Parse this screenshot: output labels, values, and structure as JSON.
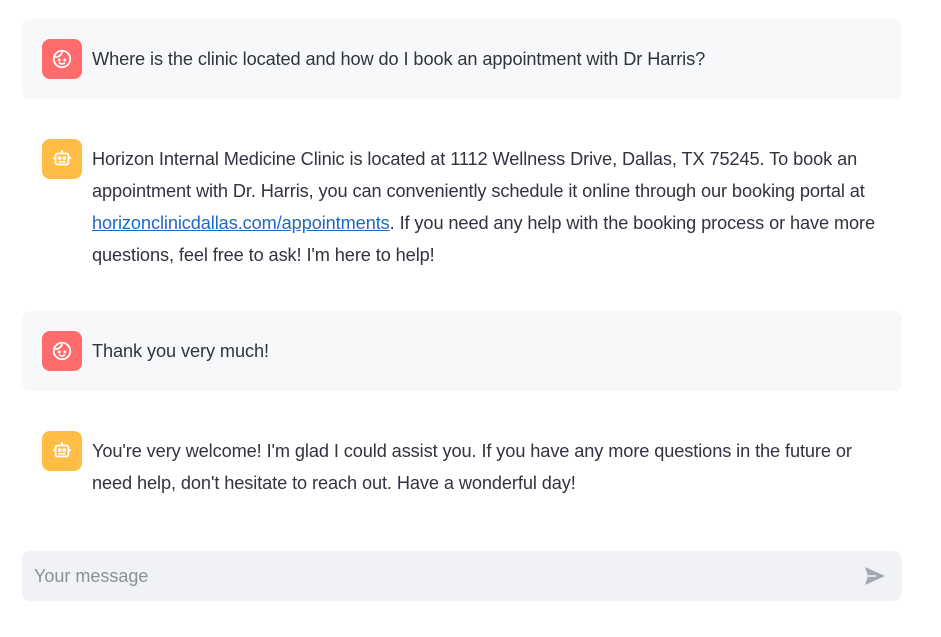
{
  "messages": [
    {
      "role": "user",
      "avatar_icon": "user-face-icon",
      "text": "Where is the clinic located and how do I book an appointment with Dr Harris?"
    },
    {
      "role": "assistant",
      "avatar_icon": "robot-icon",
      "text_before": "Horizon Internal Medicine Clinic is located at 1112 Wellness Drive, Dallas, TX 75245. To book an appointment with Dr. Harris, you can conveniently schedule it online through our booking portal at ",
      "link_text": "horizonclinicdallas.com/appointments",
      "text_after": ". If you need any help with the booking process or have more questions, feel free to ask! I'm here to help!"
    },
    {
      "role": "user",
      "avatar_icon": "user-face-icon",
      "text": "Thank you very much!"
    },
    {
      "role": "assistant",
      "avatar_icon": "robot-icon",
      "text": "You're very welcome! I'm glad I could assist you. If you have any more questions in the future or need help, don't hesitate to reach out. Have a wonderful day!"
    }
  ],
  "input": {
    "placeholder": "Your message",
    "value": "",
    "send_icon": "send-icon"
  },
  "colors": {
    "user_avatar": "#ff6b6b",
    "assistant_avatar": "#ffbd45",
    "user_bubble": "#f7f8fa",
    "input_bg": "#f0f2f6",
    "link": "#1c6bbd"
  }
}
